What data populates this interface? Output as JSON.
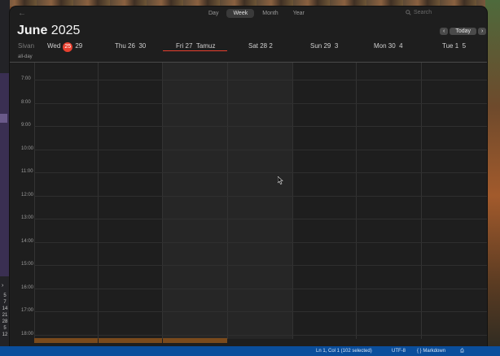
{
  "toolbar": {
    "views": [
      "Day",
      "Week",
      "Month",
      "Year"
    ],
    "active_view": "Week",
    "search_placeholder": "Search"
  },
  "header": {
    "month": "June",
    "year": "2025",
    "today_label": "Today"
  },
  "days": {
    "hebrew_month": "Sivan",
    "wed_name": "Wed",
    "wed_today": "25",
    "wed_alt": "29",
    "thu_name": "Thu 26",
    "thu_alt": "30",
    "fri_name": "Fri 27",
    "fri_alt": "Tamuz",
    "sat_name": "Sat 28",
    "sat_alt": "2",
    "sun_name": "Sun 29",
    "sun_alt": "3",
    "mon_name": "Mon 30",
    "mon_alt": "4",
    "tue_name": "Tue 1",
    "tue_alt": "5"
  },
  "allday_label": "all-day",
  "times": [
    "7:00",
    "8:00",
    "9:00",
    "10:00",
    "11:00",
    "12:00",
    "13:00",
    "14:00",
    "15:00",
    "16:00",
    "17:00",
    "18:00"
  ],
  "left_numbers": [
    "5",
    "7",
    "14",
    "21",
    "28",
    "5",
    "12"
  ],
  "statusbar": {
    "position": "Ln 1, Col 1 (102 selected)",
    "encoding": "UTF-8",
    "language": "Markdown"
  },
  "colors": {
    "today_badge": "#e8402f",
    "statusbar": "#0a4e9c",
    "event": "#7a4a1c"
  }
}
